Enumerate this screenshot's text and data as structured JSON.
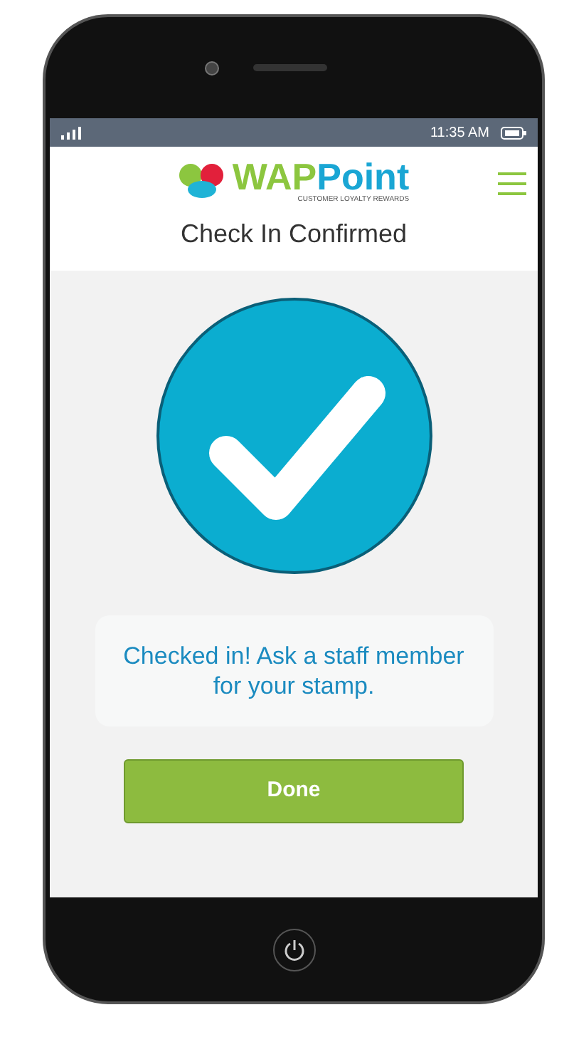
{
  "status_bar": {
    "time": "11:35 AM"
  },
  "header": {
    "logo_primary": "WAP",
    "logo_secondary": "Point",
    "tagline": "CUSTOMER LOYALTY REWARDS"
  },
  "title": "Check In Confirmed",
  "message": "Checked in! Ask a staff member for your stamp.",
  "button": {
    "label": "Done"
  }
}
